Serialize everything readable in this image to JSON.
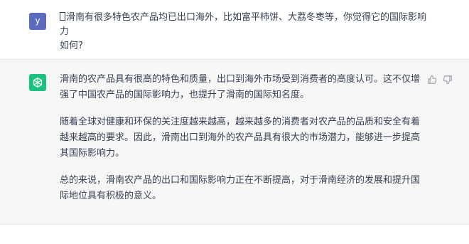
{
  "user_message": {
    "avatar_letter": "y",
    "avatar_color": "#5c6bc0",
    "text_line1": "滑南有很多特色农产品均已出口海外，比如富平柿饼、大荔冬枣等，你觉得它的国际影响力",
    "text_line2": "如何?"
  },
  "assistant_message": {
    "avatar_icon": "openai-logo-icon",
    "avatar_color": "#19c37d",
    "paragraphs": [
      "滑南的农产品具有很高的特色和质量，出口到海外市场受到消费者的高度认可。这不仅增强了中国农产品的国际影响力，也提升了滑南的国际知名度。",
      "随着全球对健康和环保的关注度越来越高，越来越多的消费者对农产品的品质和安全有着越来越高的要求。因此，滑南出口到海外的农产品具有很大的市场潜力，能够进一步提高其国际影响力。",
      "总的来说，滑南农产品的出口和国际影响力正在不断提高，对于滑南经济的发展和提升国际地位具有积极的意义。"
    ],
    "actions": {
      "like_icon": "thumbs-up-icon",
      "dislike_icon": "thumbs-down-icon"
    }
  }
}
